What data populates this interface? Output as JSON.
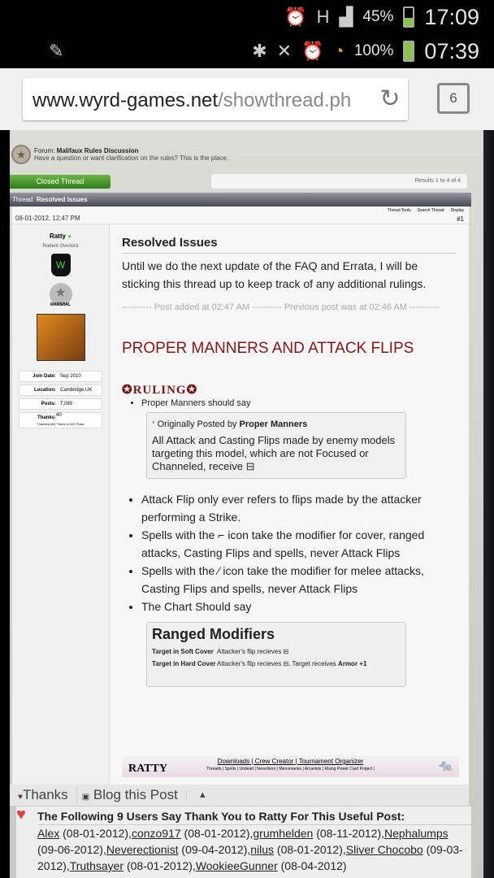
{
  "status_outer": {
    "battery": "45%",
    "time": "17:09",
    "network": "H"
  },
  "status_inner": {
    "battery": "100%",
    "time": "07:39"
  },
  "browser": {
    "url_domain": "www.wyrd-games.net",
    "url_path": "/showthread.ph",
    "tab_count": "6"
  },
  "forum": {
    "label": "Forum:",
    "name": "Malifaux Rules Discussion",
    "description": "Have a question or want clarification on the rules? This is the place."
  },
  "closed_thread": "Closed Thread",
  "results": "Results 1 to 4 of 4",
  "thread": {
    "label": "Thread:",
    "title": "Resolved Issues"
  },
  "post": {
    "date": "08-01-2012, 12:47 PM",
    "tools": [
      "Thread Tools",
      "Search Thread",
      "Display"
    ],
    "number": "#1"
  },
  "user": {
    "name": "Ratty",
    "title": "Rodent Overlord",
    "badge": "MARSHAL",
    "stats": [
      {
        "label": "Join Date:",
        "value": "Sep 2010"
      },
      {
        "label": "Location:",
        "value": "Cambridge,UK"
      },
      {
        "label": "Posts:",
        "value": "7,089"
      },
      {
        "label": "Thanks:",
        "value": "40"
      }
    ],
    "thanked": "Thanked 451 Times in 223 Posts"
  },
  "content": {
    "title": "Resolved Issues",
    "intro": "Until we do the next update of the FAQ and Errata, I will be sticking this thread up to keep track of any additional rulings.",
    "added": "---------- Post added at 02:47 AM ---------- Previous post was at 02:46 AM ----------",
    "heading": "PROPER MANNERS AND ATTACK FLIPS",
    "ruling": "RULING",
    "bullet1": "Proper Manners should say",
    "quote_prefix": "Originally Posted by",
    "quote_author": "Proper Manners",
    "quote_text": "All Attack and Casting Flips made by enemy models targeting this model, which are not Focused or Channeled, receive",
    "bullets": [
      "Attack Flip only ever refers to flips made by the attacker performing a Strike.",
      "Spells with the ⌐ icon take the modifier for cover, ranged attacks, Casting Flips and spells, never Attack Flips",
      "Spells with the ⁄ icon take the modifier for melee attacks, Casting Flips and spells, never Attack Flips",
      "The Chart Should say"
    ],
    "modifiers": {
      "title": "Ranged Modifiers",
      "rows": [
        {
          "label": "Target in Soft Cover",
          "text": "Attacker's flip recieves ⊟"
        },
        {
          "label": "Target in Hard Cover",
          "text": "Attacker's flip recieves ⊟. Target receives",
          "extra": "Armor +1"
        }
      ]
    }
  },
  "signature": {
    "name": "RATTY",
    "links": "Downloads | Crew Creator | Tournament Organizer",
    "threads": "Threads | Spirits | Undead | Neverborn | Mercenaries | Arcanists | Rising Power Card Project |"
  },
  "actions": {
    "thanks": "Thanks",
    "blog": "Blog this Post"
  },
  "thanks_list": {
    "heading": "The Following 9 Users Say Thank You to Ratty For This Useful Post:",
    "users": [
      {
        "name": "Alex",
        "date": "(08-01-2012)"
      },
      {
        "name": "conzo917",
        "date": "(08-01-2012)"
      },
      {
        "name": "grumhelden",
        "date": "(08-11-2012)"
      },
      {
        "name": "Nephalumps",
        "date": "(09-06-2012)"
      },
      {
        "name": "Neverectionist",
        "date": "(09-04-2012)"
      },
      {
        "name": "nilus",
        "date": "(08-01-2012)"
      },
      {
        "name": "Sliver Chocobo",
        "date": "(09-03-2012)"
      },
      {
        "name": "Truthsayer",
        "date": "(08-01-2012)"
      },
      {
        "name": "WookieeGunner",
        "date": "(08-04-2012)"
      }
    ]
  }
}
